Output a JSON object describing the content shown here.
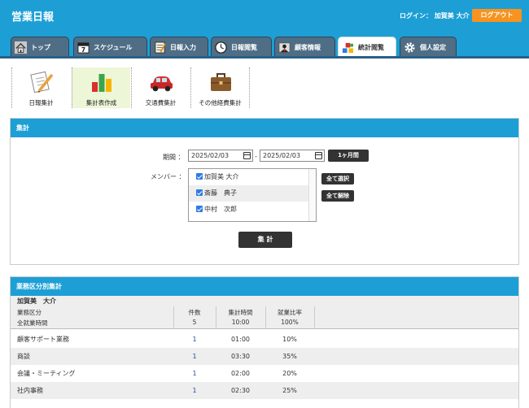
{
  "header": {
    "title": "営業日報",
    "login_text": "ログイン： 加賀美 大介",
    "logout_label": "ログアウト"
  },
  "tabs": [
    {
      "label": "トップ",
      "icon": "house-icon"
    },
    {
      "label": "スケジュール",
      "icon": "calendar-icon"
    },
    {
      "label": "日報入力",
      "icon": "notepad-icon"
    },
    {
      "label": "日報閲覧",
      "icon": "clock-icon"
    },
    {
      "label": "顧客情報",
      "icon": "customer-icon"
    },
    {
      "label": "統計閲覧",
      "icon": "blocks-icon",
      "active": true
    },
    {
      "label": "個人設定",
      "icon": "gear-icon"
    }
  ],
  "subnav": [
    {
      "label": "日報集計",
      "icon": "report-pencil-icon"
    },
    {
      "label": "集計表作成",
      "icon": "bar-chart-icon",
      "active": true
    },
    {
      "label": "交通費集計",
      "icon": "car-icon"
    },
    {
      "label": "その他経費集計",
      "icon": "briefcase-icon"
    }
  ],
  "aggregate": {
    "title": "集計",
    "period_label": "期間 ：",
    "date_from": "2025/02/03",
    "date_sep": "-",
    "date_to": "2025/02/03",
    "one_month_label": "1ヶ月間",
    "members_label": "メンバー ：",
    "members": [
      "加賀美 大介",
      "斎藤　典子",
      "中村　次郎"
    ],
    "select_all_label": "全て選択",
    "deselect_all_label": "全て解除",
    "submit_label": "集 計"
  },
  "category_summary": {
    "title": "業務区分別集計",
    "person": "加賀美　大介",
    "headers": {
      "category": "業務区分",
      "count": "件数",
      "time": "集計時間",
      "ratio": "就業比率"
    },
    "total": {
      "label": "全就業時間",
      "count": "5",
      "time": "10:00",
      "ratio": "100%"
    },
    "rows": [
      {
        "category": "顧客サポート業務",
        "count": "1",
        "time": "01:00",
        "ratio": "10%"
      },
      {
        "category": "商談",
        "count": "1",
        "time": "03:30",
        "ratio": "35%"
      },
      {
        "category": "会議・ミーティング",
        "count": "1",
        "time": "02:00",
        "ratio": "20%"
      },
      {
        "category": "社内事務",
        "count": "1",
        "time": "02:30",
        "ratio": "25%"
      }
    ]
  },
  "colors": {
    "header_blue": "#1d9fd6",
    "tab_dark": "#4f6e86",
    "logout_orange": "#f7931e",
    "number_blue": "#2a4b9b"
  }
}
